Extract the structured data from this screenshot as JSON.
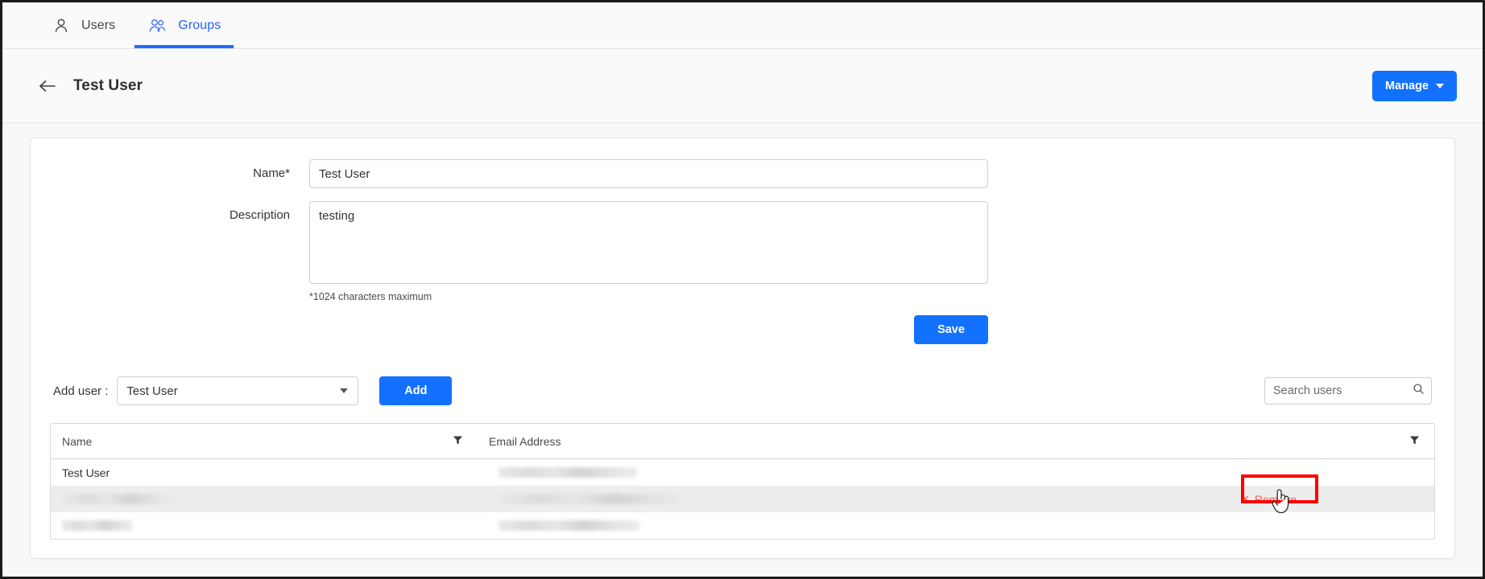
{
  "tabs": [
    {
      "label": "Users",
      "icon": "single-user-icon",
      "active": false
    },
    {
      "label": "Groups",
      "icon": "group-users-icon",
      "active": true
    }
  ],
  "header": {
    "back_icon": "back-arrow-icon",
    "title": "Test User",
    "manage_label": "Manage",
    "manage_caret_icon": "chevron-down-icon"
  },
  "form": {
    "name_label": "Name*",
    "name_value": "Test User",
    "name_placeholder": "",
    "description_label": "Description",
    "description_value": "testing",
    "description_placeholder": "",
    "hint": "*1024 characters maximum",
    "save_label": "Save"
  },
  "adduser": {
    "label": "Add user :",
    "selected_user": "Test User",
    "caret_icon": "chevron-down-icon",
    "add_label": "Add",
    "search_placeholder": "Search users",
    "search_value": "",
    "search_icon": "search-icon"
  },
  "table": {
    "columns": [
      {
        "header": "Name",
        "filter_icon": "filter-funnel-icon"
      },
      {
        "header": "Email Address",
        "filter_icon": "filter-funnel-icon"
      }
    ],
    "rows": [
      {
        "name": "Test User",
        "name_redacted": false,
        "email": "",
        "email_redacted": true,
        "highlighted": false
      },
      {
        "name": "",
        "name_redacted": true,
        "email": "",
        "email_redacted": true,
        "highlighted": true
      },
      {
        "name": "",
        "name_redacted": true,
        "email": "",
        "email_redacted": true,
        "highlighted": false
      }
    ],
    "remove_label": "Remove",
    "remove_x_icon": "close-x-icon"
  },
  "annotation": {
    "highlight_color": "#ff0000",
    "cursor_icon": "pointing-hand-cursor"
  },
  "colors": {
    "accent": "#1271ff",
    "tab_active": "#2962ff",
    "remove": "#ff5b5b",
    "page_bg": "#f8f8f8",
    "header_bg": "#fafafa"
  }
}
